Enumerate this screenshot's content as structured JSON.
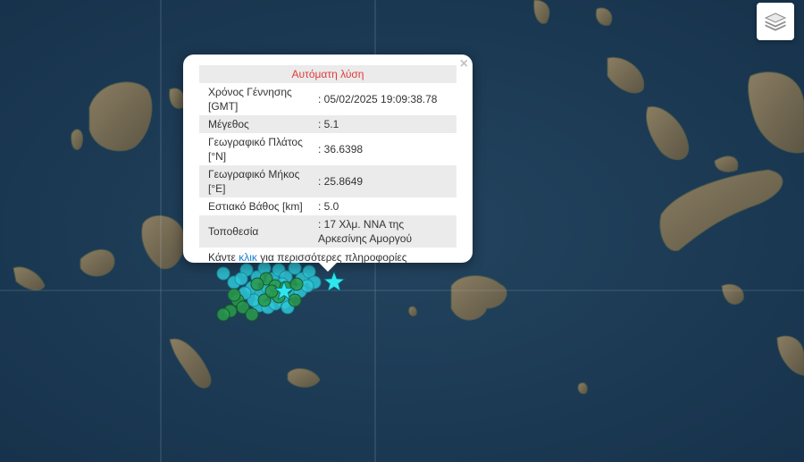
{
  "popup": {
    "title": "Αυτόματη λύση",
    "close": "×",
    "rows": [
      {
        "label": "Χρόνος Γέννησης [GMT]",
        "value": ": 05/02/2025 19:09:38.78"
      },
      {
        "label": "Μέγεθος",
        "value": ": 5.1"
      },
      {
        "label": "Γεωγραφικό Πλάτος [°N]",
        "value": ": 36.6398"
      },
      {
        "label": "Γεωγραφικό Μήκος [°E]",
        "value": ": 25.8649"
      },
      {
        "label": "Εστιακό Βάθος [km]",
        "value": ": 5.0"
      },
      {
        "label": "Τοποθεσία",
        "value": ": 17 Χλμ. ΝΝΑ της Αρκεσίνης Αμοργού"
      }
    ],
    "more_prefix": "Κάντε ",
    "more_link": "κλικ",
    "more_suffix": " για περισσότερες πληροφορίες"
  },
  "layers_button": {
    "icon": "layers-icon"
  },
  "colors": {
    "sea": "#1c3a55",
    "land": "#6e6450",
    "marker_cyan": "#2ec8d8",
    "marker_green": "#2a9a4c",
    "star": "#2ee6ee"
  }
}
